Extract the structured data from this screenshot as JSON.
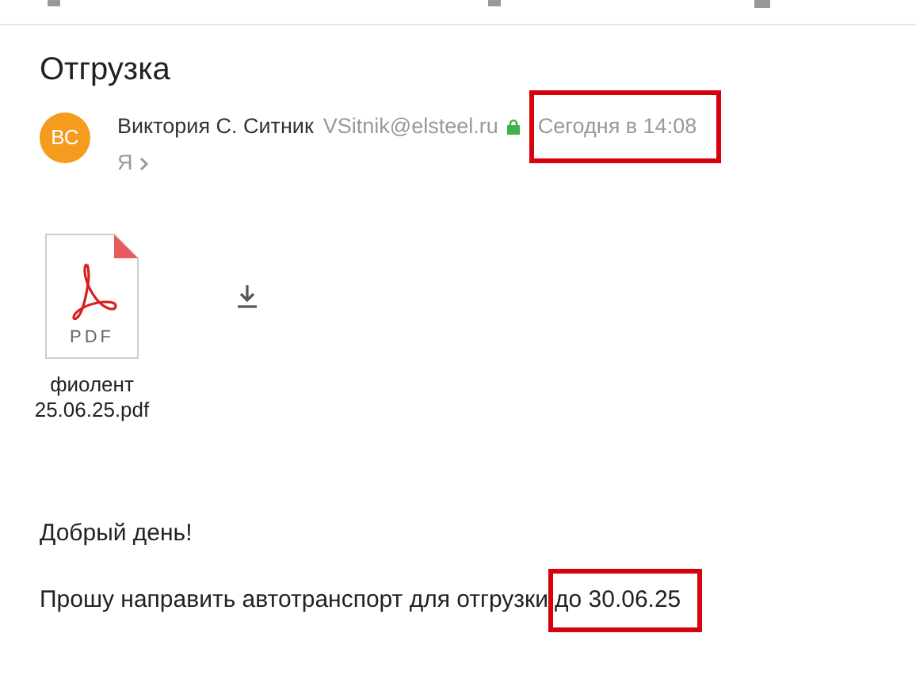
{
  "subject": "Отгрузка",
  "sender": {
    "initials": "ВС",
    "name": "Виктория С. Ситник",
    "email": "VSitnik@elsteel.ru",
    "secure": true,
    "time": "Сегодня в 14:08",
    "time_highlighted": true
  },
  "recipient": "Я",
  "attachment": {
    "type_label": "PDF",
    "name_lines": [
      "фиолент",
      "25.06.25.pdf"
    ]
  },
  "body": [
    {
      "text": "Добрый день!"
    },
    {
      "text": "Прошу направить автотранспорт для отгрузки",
      "highlighted_tail": "до 30.06.25"
    }
  ]
}
